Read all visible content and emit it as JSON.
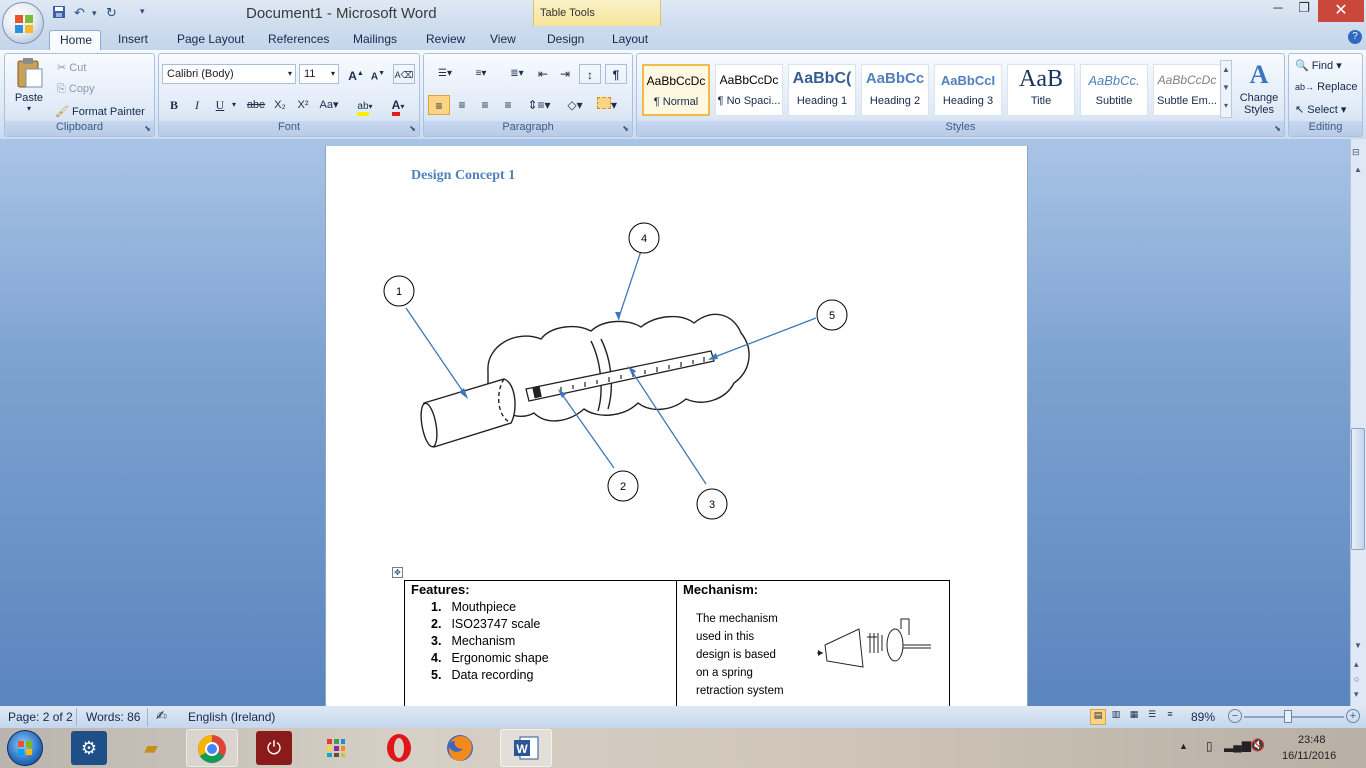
{
  "window": {
    "title": "Document1 - Microsoft Word",
    "context_tab_group": "Table Tools"
  },
  "quick_access": {
    "save": "save-icon",
    "undo": "undo-icon",
    "redo": "redo-icon",
    "customize": "customize-icon"
  },
  "tabs": [
    "Home",
    "Insert",
    "Page Layout",
    "References",
    "Mailings",
    "Review",
    "View",
    "Design",
    "Layout"
  ],
  "active_tab": "Home",
  "ribbon": {
    "clipboard": {
      "label": "Clipboard",
      "paste": "Paste",
      "cut": "Cut",
      "copy": "Copy",
      "format_painter": "Format Painter"
    },
    "font": {
      "label": "Font",
      "name": "Calibri (Body)",
      "size": "11",
      "bold": "B",
      "italic": "I",
      "underline": "U",
      "strike": "abe",
      "subscript": "X₂",
      "superscript": "X²",
      "change_case": "Aa",
      "grow": "A",
      "shrink": "A"
    },
    "paragraph": {
      "label": "Paragraph",
      "show_marks": "¶"
    },
    "styles": {
      "label": "Styles",
      "items": [
        {
          "preview": "AaBbCcDc",
          "name": "¶ Normal"
        },
        {
          "preview": "AaBbCcDc",
          "name": "¶ No Spaci..."
        },
        {
          "preview": "AaBbC(",
          "name": "Heading 1"
        },
        {
          "preview": "AaBbCc",
          "name": "Heading 2"
        },
        {
          "preview": "AaBbCcI",
          "name": "Heading 3"
        },
        {
          "preview": "AaB",
          "name": "Title"
        },
        {
          "preview": "AaBbCc.",
          "name": "Subtitle"
        },
        {
          "preview": "AaBbCcDc",
          "name": "Subtle Em..."
        }
      ],
      "change_styles": "Change Styles"
    },
    "editing": {
      "label": "Editing",
      "find": "Find",
      "replace": "Replace",
      "select": "Select"
    }
  },
  "document": {
    "heading": "Design Concept 1",
    "callouts": [
      "1",
      "2",
      "3",
      "4",
      "5"
    ],
    "table": {
      "features_header": "Features:",
      "features": [
        "Mouthpiece",
        "ISO23747 scale",
        "Mechanism",
        "Ergonomic shape",
        "Data recording"
      ],
      "mechanism_header": "Mechanism:",
      "mechanism_lines": [
        "The mechanism",
        "used in this",
        "design is based",
        "on a spring",
        "retraction system"
      ]
    }
  },
  "status": {
    "page": "Page: 2 of 2",
    "words": "Words: 86",
    "language": "English (Ireland)",
    "zoom": "89%"
  },
  "taskbar": {
    "apps": [
      "control-panel-icon",
      "file-explorer-icon",
      "chrome-icon",
      "power-icon",
      "apps-grid-icon",
      "opera-icon",
      "firefox-icon",
      "word-icon"
    ],
    "time": "23:48",
    "date": "16/11/2016"
  }
}
